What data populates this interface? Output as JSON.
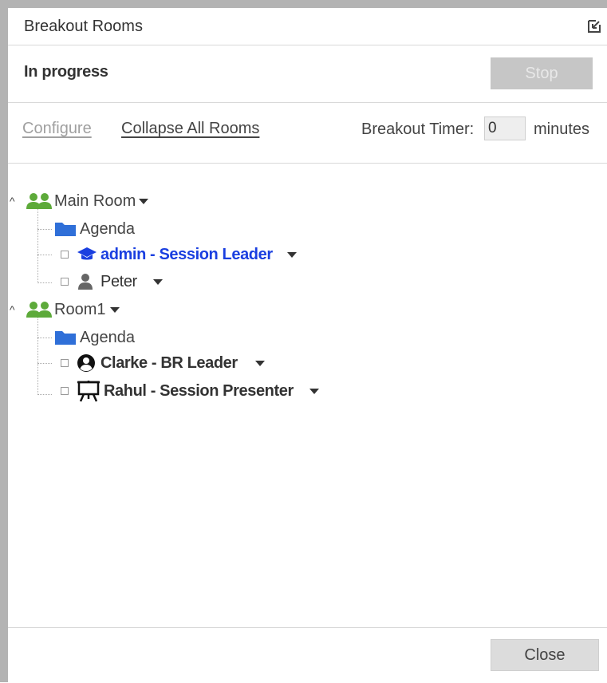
{
  "header": {
    "title": "Breakout Rooms",
    "popout_icon": "popout-icon"
  },
  "status": {
    "text": "In progress",
    "stop_label": "Stop"
  },
  "config": {
    "configure_label": "Configure",
    "collapse_label": "Collapse All Rooms",
    "timer_label": "Breakout Timer:",
    "timer_value": "0",
    "timer_unit": "minutes"
  },
  "rooms": [
    {
      "name": "Main Room",
      "agenda": "Agenda",
      "users": [
        {
          "name": "admin - Session Leader",
          "icon": "graduation-cap-icon"
        },
        {
          "name": "Peter",
          "icon": "person-icon"
        }
      ]
    },
    {
      "name": "Room1",
      "agenda": "Agenda",
      "users": [
        {
          "name": "Clarke - BR Leader",
          "icon": "user-circle-icon"
        },
        {
          "name": "Rahul - Session Presenter",
          "icon": "presenter-easel-icon"
        }
      ]
    }
  ],
  "footer": {
    "close_label": "Close"
  },
  "colors": {
    "leader_blue": "#1a3fe0",
    "room_green": "#5daa3a",
    "folder_blue": "#2f6fd8",
    "stop_disabled": "#c6c6c6"
  }
}
